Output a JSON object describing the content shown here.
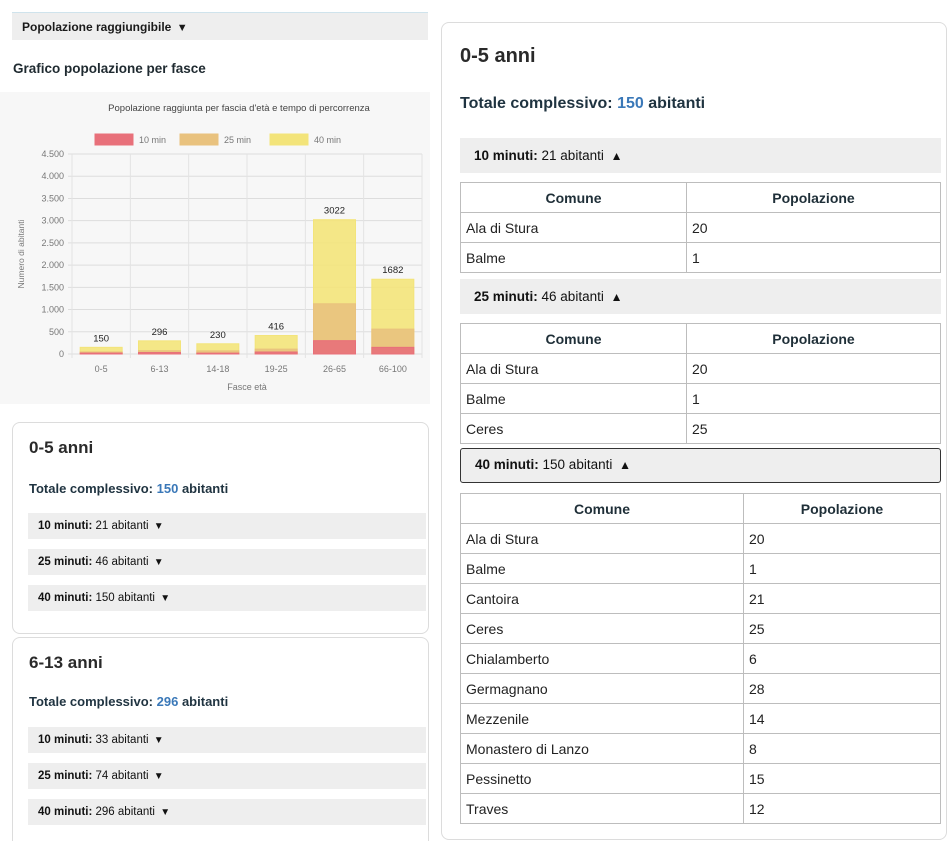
{
  "toggle": {
    "label": "Popolazione raggiungibile",
    "arrow": "▼"
  },
  "chart_heading": "Grafico popolazione per fasce",
  "chart_data": {
    "type": "bar",
    "stacked": true,
    "title": "Popolazione raggiunta per fascia d'età e tempo di percorrenza",
    "xlabel": "Fasce età",
    "ylabel": "Numero di abitanti",
    "categories": [
      "0-5",
      "6-13",
      "14-18",
      "19-25",
      "26-65",
      "66-100"
    ],
    "ylim": [
      0,
      4500
    ],
    "yticks": [
      0,
      500,
      1000,
      1500,
      2000,
      2500,
      3000,
      3500,
      4000,
      4500
    ],
    "ytick_labels": [
      "0",
      "500",
      "1.000",
      "1.500",
      "2.000",
      "2.500",
      "3.000",
      "3.500",
      "4.000",
      "4.500"
    ],
    "legend_position": "top",
    "series": [
      {
        "name": "10 min",
        "color": "#e8707a",
        "values": [
          21,
          33,
          20,
          45,
          300,
          150
        ]
      },
      {
        "name": "25 min",
        "color": "#e9c27e",
        "values": [
          46,
          74,
          70,
          110,
          1130,
          560
        ]
      },
      {
        "name": "40 min",
        "color": "#f3e47a",
        "values": [
          150,
          296,
          230,
          416,
          3022,
          1682
        ]
      }
    ],
    "data_labels": [
      "150",
      "296",
      "230",
      "416",
      "3022",
      "1682"
    ],
    "grid": true
  },
  "left_cards": [
    {
      "title": "0-5 anni",
      "total_prefix": "Totale complessivo: ",
      "total_value": "150",
      "total_suffix": " abitanti",
      "rows": [
        {
          "label": "10 minuti:",
          "value": "21 abitanti",
          "arrow": "▼"
        },
        {
          "label": "25 minuti:",
          "value": "46 abitanti",
          "arrow": "▼"
        },
        {
          "label": "40 minuti:",
          "value": "150 abitanti",
          "arrow": "▼"
        }
      ]
    },
    {
      "title": "6-13 anni",
      "total_prefix": "Totale complessivo: ",
      "total_value": "296",
      "total_suffix": " abitanti",
      "rows": [
        {
          "label": "10 minuti:",
          "value": "33 abitanti",
          "arrow": "▼"
        },
        {
          "label": "25 minuti:",
          "value": "74 abitanti",
          "arrow": "▼"
        },
        {
          "label": "40 minuti:",
          "value": "296 abitanti",
          "arrow": "▼"
        }
      ]
    }
  ],
  "right_panel": {
    "title": "0-5 anni",
    "total_prefix": "Totale complessivo: ",
    "total_value": "150",
    "total_suffix": " abitanti",
    "col_comune": "Comune",
    "col_popolazione": "Popolazione",
    "sections": [
      {
        "label": "10 minuti:",
        "value": "21 abitanti",
        "arrow": "▲",
        "rows": [
          [
            "Ala di Stura",
            "20"
          ],
          [
            "Balme",
            "1"
          ]
        ]
      },
      {
        "label": "25 minuti:",
        "value": "46 abitanti",
        "arrow": "▲",
        "rows": [
          [
            "Ala di Stura",
            "20"
          ],
          [
            "Balme",
            "1"
          ],
          [
            "Ceres",
            "25"
          ]
        ]
      },
      {
        "label": "40 minuti:",
        "value": "150 abitanti",
        "arrow": "▲",
        "rows": [
          [
            "Ala di Stura",
            "20"
          ],
          [
            "Balme",
            "1"
          ],
          [
            "Cantoira",
            "21"
          ],
          [
            "Ceres",
            "25"
          ],
          [
            "Chialamberto",
            "6"
          ],
          [
            "Germagnano",
            "28"
          ],
          [
            "Mezzenile",
            "14"
          ],
          [
            "Monastero di Lanzo",
            "8"
          ],
          [
            "Pessinetto",
            "15"
          ],
          [
            "Traves",
            "12"
          ]
        ]
      }
    ]
  }
}
